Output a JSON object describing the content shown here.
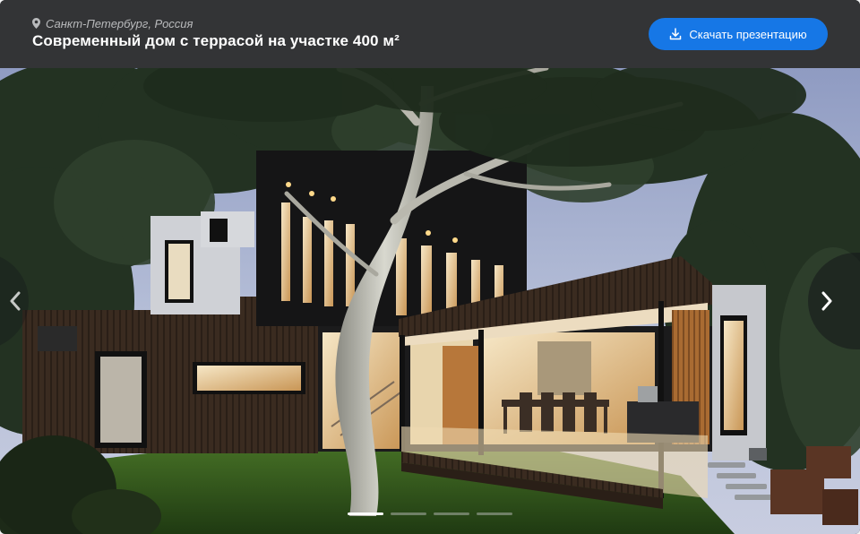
{
  "header": {
    "location": "Санкт-Петербург, Россия",
    "title": "Современный дом с террасой на участке 400 м²",
    "download_label": "Скачать презентацию"
  },
  "colors": {
    "header_bg": "#333436",
    "button_bg": "#1677e6",
    "text_primary": "#ffffff",
    "text_secondary": "#b9babc"
  },
  "icons": {
    "location": "map-pin-icon",
    "download": "download-icon",
    "prev": "chevron-left-icon",
    "next": "chevron-right-icon"
  },
  "carousel": {
    "slide_count": 4,
    "active_index": 0
  }
}
